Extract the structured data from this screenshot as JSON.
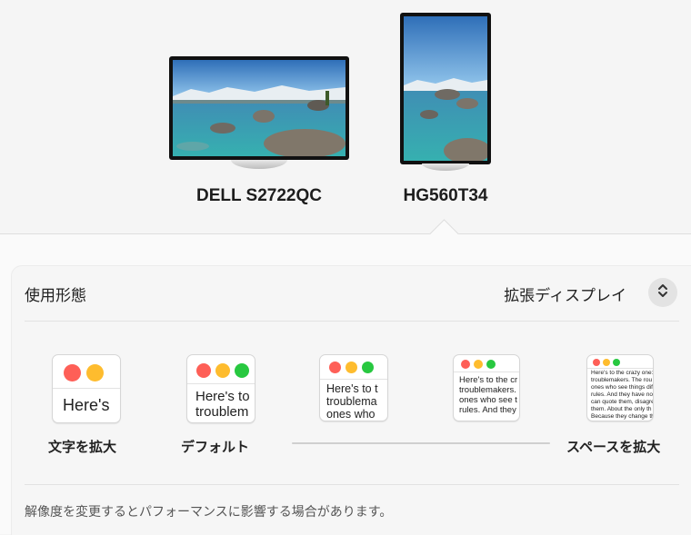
{
  "displays": [
    {
      "name": "DELL S2722QC",
      "orientation": "landscape",
      "selected": false
    },
    {
      "name": "HG560T34",
      "orientation": "portrait",
      "selected": true
    }
  ],
  "usage": {
    "label": "使用形態",
    "value": "拡張ディスプレイ",
    "stepper_icon": "chevron-up-down-icon"
  },
  "resolution_options": [
    {
      "preview_text": "Here's",
      "label": "文字を拡大",
      "selected": false
    },
    {
      "preview_text": "Here's to\ntroublem",
      "label": "デフォルト",
      "selected": false
    },
    {
      "preview_text": "Here's to t\ntroublema\nones who",
      "label": "",
      "selected": false
    },
    {
      "preview_text": "Here's to the cr\ntroublemakers.\nones who see t\nrules. And they",
      "label": "",
      "selected": false
    },
    {
      "preview_text": "Here's to the crazy one:\ntroublemakers. The rou\nones who see things dif\nrules. And they have no\ncan quote them, disagre\nthem. About the only th\nBecause they change th",
      "label": "スペースを拡大",
      "selected": false
    }
  ],
  "note": "解像度を変更するとパフォーマンスに影響する場合があります。",
  "colors": {
    "close": "#fe5f57",
    "minimize": "#febc2e",
    "zoom": "#28c840"
  }
}
